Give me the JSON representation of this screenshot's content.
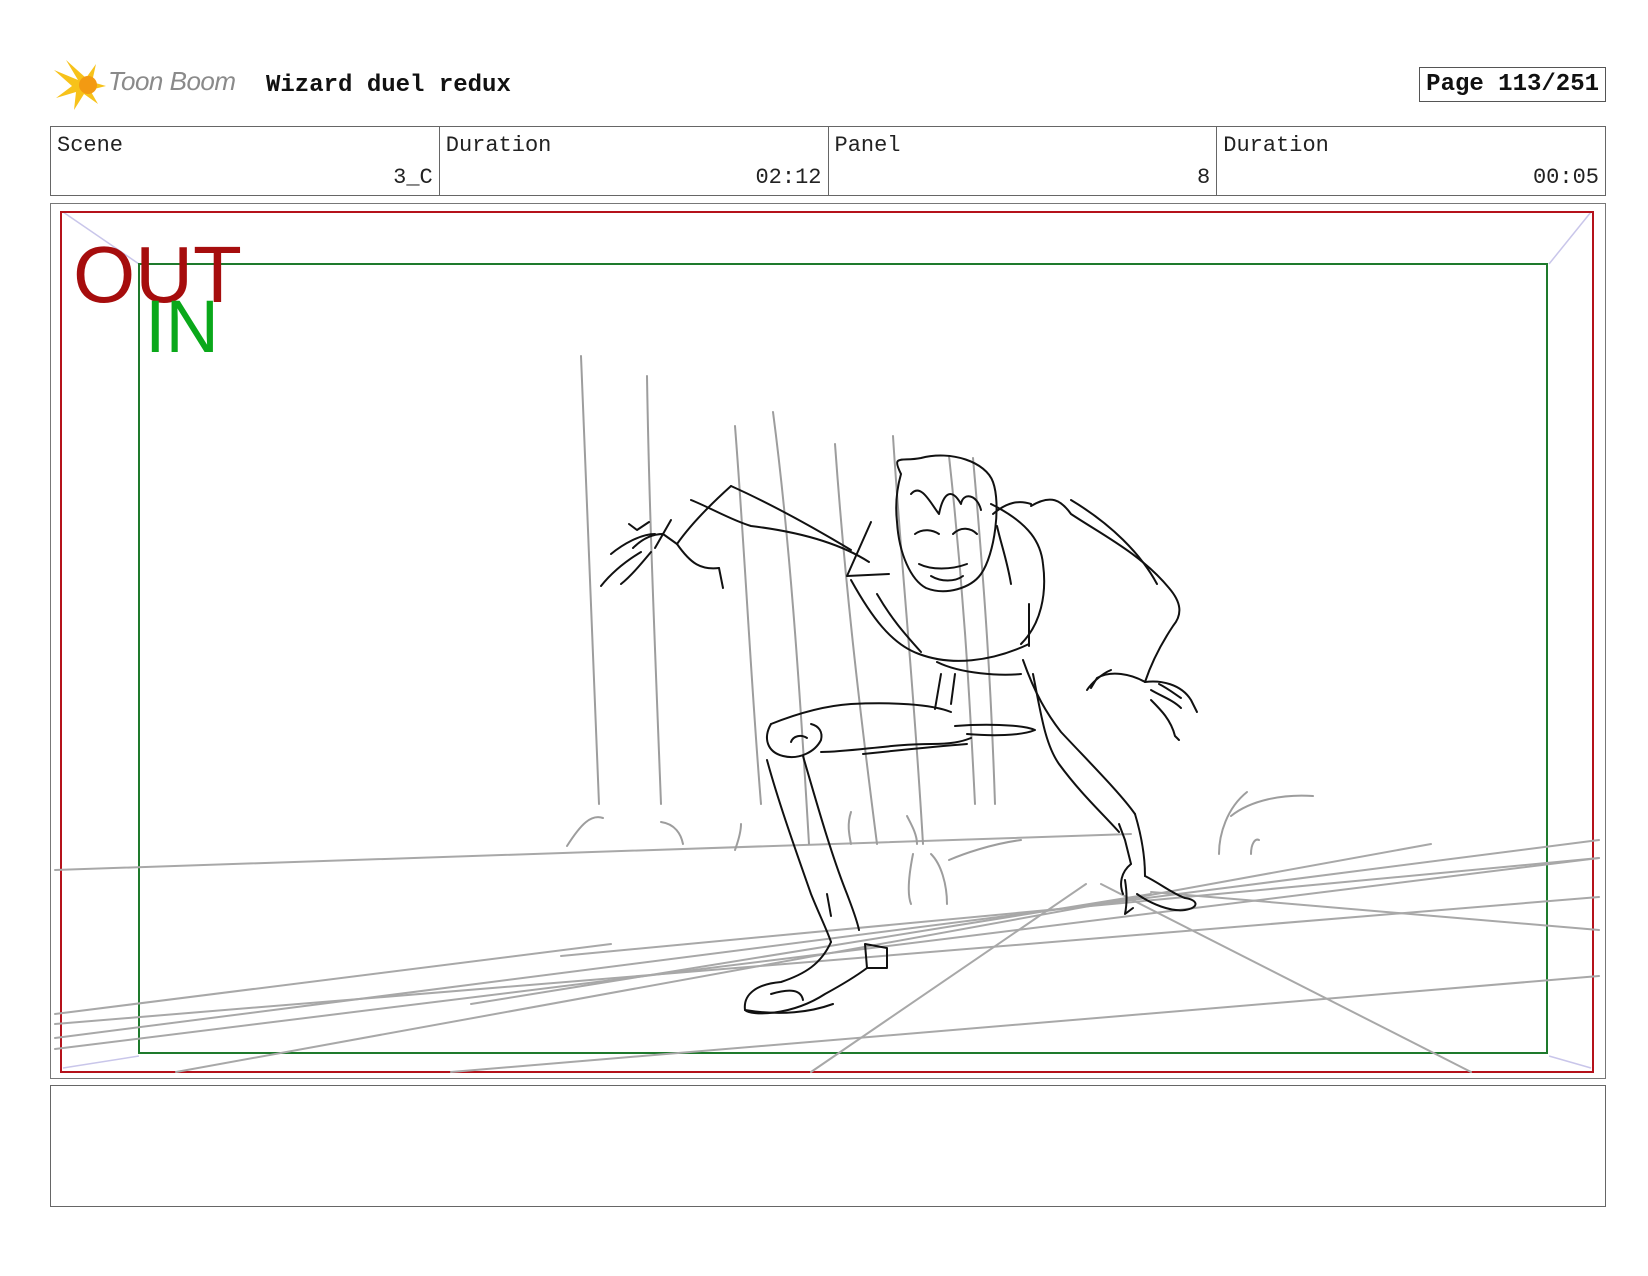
{
  "header": {
    "logo_text": "Toon Boom",
    "project_title": "Wizard duel redux",
    "page_label": "Page 113/251"
  },
  "info": [
    {
      "label": "Scene",
      "value": "3_C"
    },
    {
      "label": "Duration",
      "value": "02:12"
    },
    {
      "label": "Panel",
      "value": "8"
    },
    {
      "label": "Duration",
      "value": "00:05"
    }
  ],
  "panel": {
    "safe_labels": {
      "out": "OUT",
      "in": "IN"
    },
    "colors": {
      "out_frame": "#b5121b",
      "in_frame": "#1e7a2c",
      "sketch": "#111111",
      "guides": "#a8a8a8"
    }
  },
  "notes": {
    "text": ""
  }
}
